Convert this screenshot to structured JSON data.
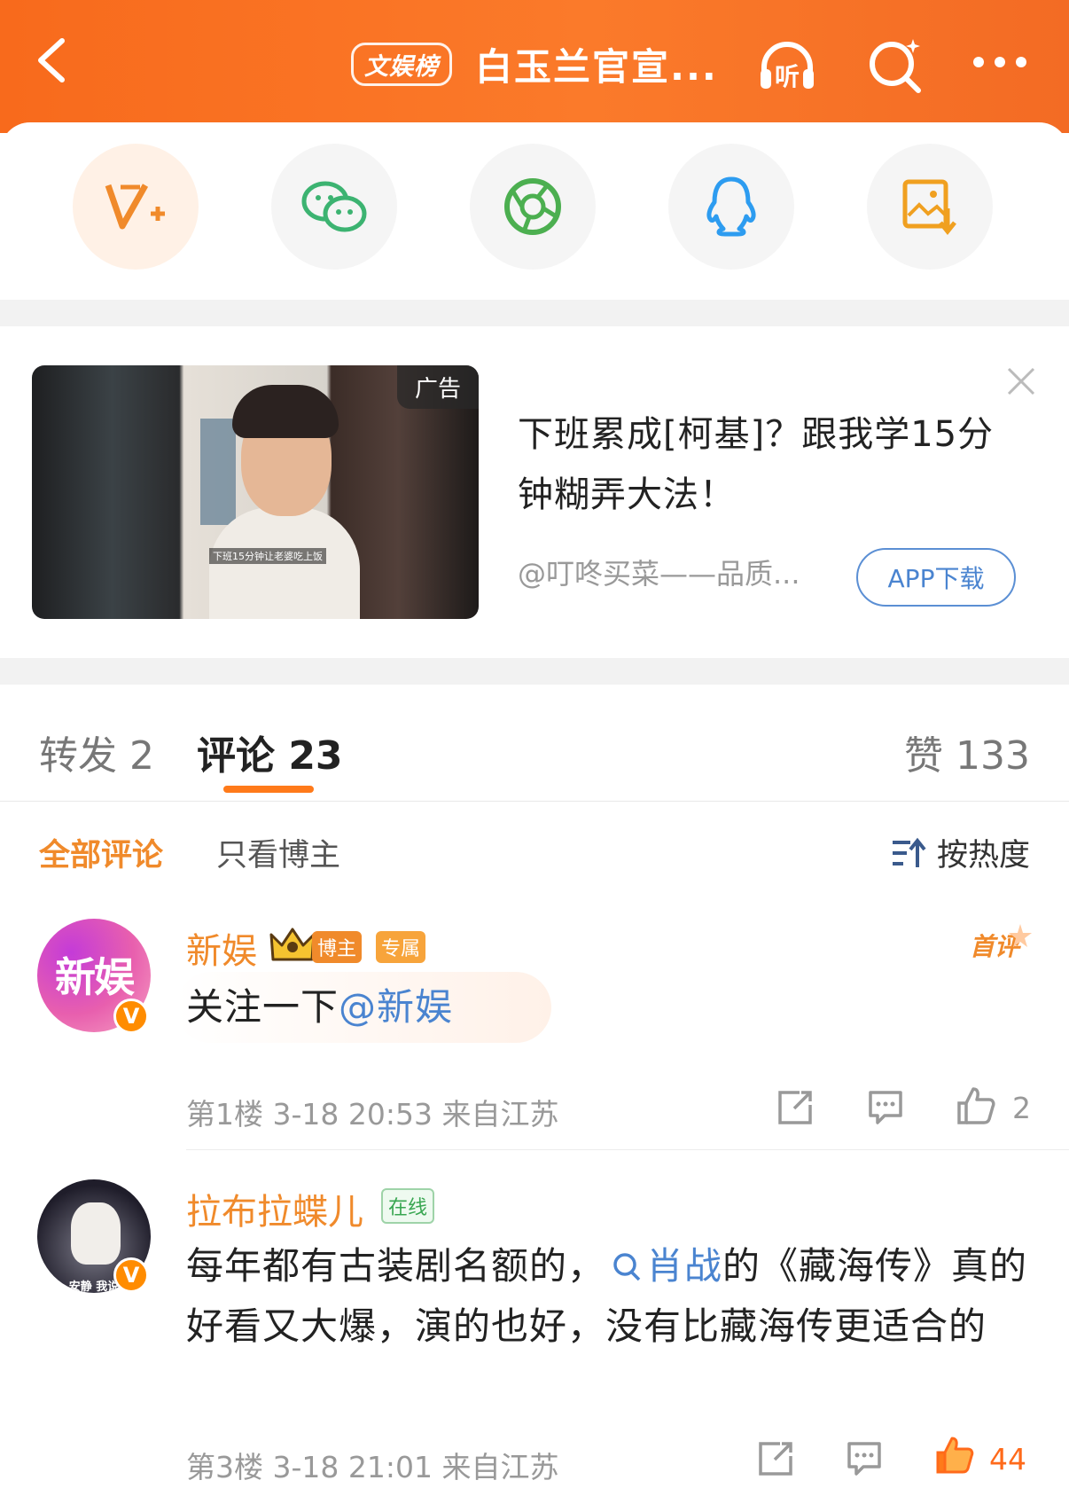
{
  "header": {
    "rank_badge": "文娱榜",
    "title": "白玉兰官宣...",
    "icons": [
      "back-icon",
      "listen-icon",
      "search-icon",
      "more-icon"
    ],
    "listen_label": "听"
  },
  "share_sheet": {
    "items": [
      "weibo-repost-icon",
      "wechat-icon",
      "moments-icon",
      "qq-icon",
      "save-image-icon"
    ]
  },
  "ad": {
    "badge": "广告",
    "thumb_caption": "下班15分钟让老婆吃上饭",
    "text": "下班累成[柯基]？跟我学15分钟糊弄大法！",
    "source": "@叮咚买菜——品质...",
    "download_label": "APP下载"
  },
  "tabs": {
    "repost": "转发 2",
    "comments": "评论 23",
    "likes": "赞 133"
  },
  "filters": {
    "all": "全部评论",
    "author_only": "只看博主",
    "sort": "按热度"
  },
  "comments": [
    {
      "avatar_text": "新娱",
      "username": "新娱",
      "tags": [
        "博主",
        "专属"
      ],
      "first_badge": "首评",
      "text_prefix": "关注一下",
      "mention": "@新娱",
      "meta": "第1楼 3-18 20:53 来自江苏",
      "likes": "2"
    },
    {
      "avatar_caption": "安静 我说",
      "username": "拉布拉蝶儿",
      "status": "在线",
      "text_a": "每年都有古装剧名额的，",
      "topic": "肖战",
      "text_b": "的《藏海传》真的好看又大爆，演的也好，没有比藏海传更适合的",
      "meta": "第3楼 3-18 21:01 来自江苏",
      "likes": "44"
    }
  ],
  "colors": {
    "accent": "#ff7a1a",
    "link": "#4a84d0",
    "username": "#f08a2b",
    "liked": "#ff6a1a"
  }
}
